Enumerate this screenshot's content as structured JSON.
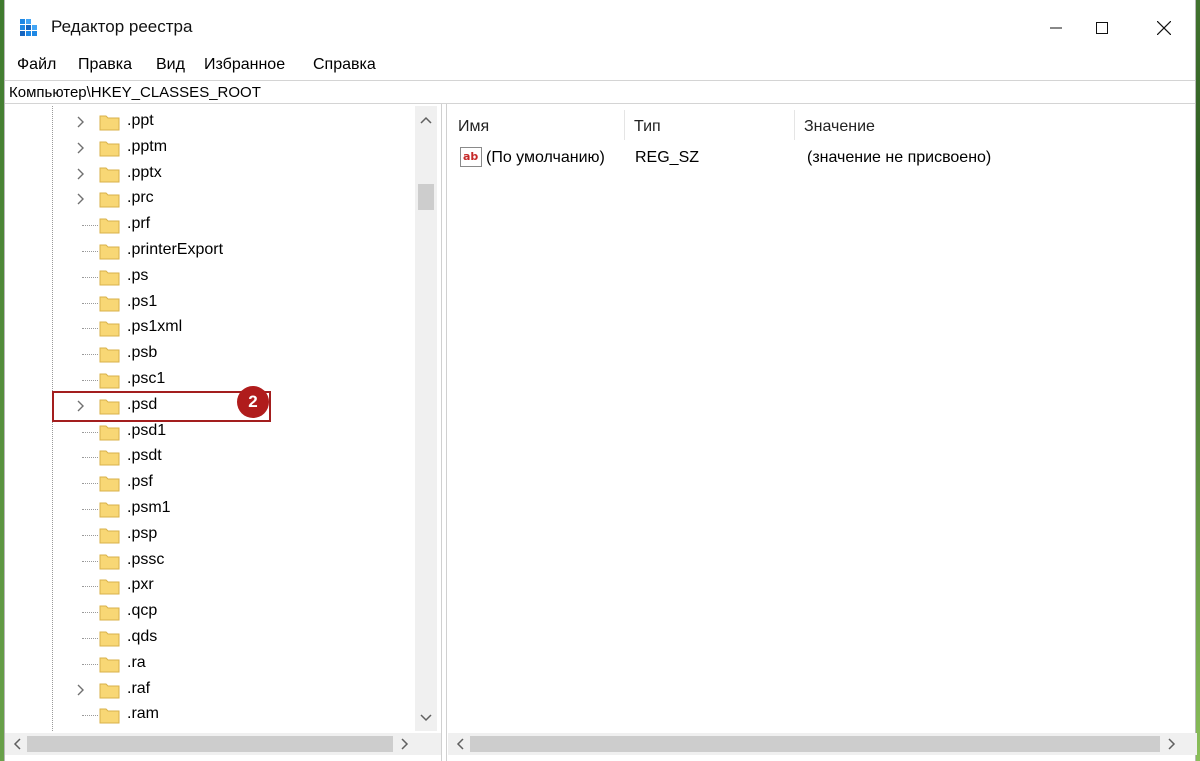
{
  "window": {
    "title": "Редактор реестра"
  },
  "menu": {
    "items": [
      "Файл",
      "Правка",
      "Вид",
      "Избранное",
      "Справка"
    ]
  },
  "address": {
    "path": "Компьютер\\HKEY_CLASSES_ROOT"
  },
  "tree": {
    "items": [
      {
        "label": ".ppt",
        "expandable": true
      },
      {
        "label": ".pptm",
        "expandable": true
      },
      {
        "label": ".pptx",
        "expandable": true
      },
      {
        "label": ".prc",
        "expandable": true
      },
      {
        "label": ".prf",
        "expandable": false
      },
      {
        "label": ".printerExport",
        "expandable": false
      },
      {
        "label": ".ps",
        "expandable": false
      },
      {
        "label": ".ps1",
        "expandable": false
      },
      {
        "label": ".ps1xml",
        "expandable": false
      },
      {
        "label": ".psb",
        "expandable": false
      },
      {
        "label": ".psc1",
        "expandable": false
      },
      {
        "label": ".psd",
        "expandable": true
      },
      {
        "label": ".psd1",
        "expandable": false
      },
      {
        "label": ".psdt",
        "expandable": false
      },
      {
        "label": ".psf",
        "expandable": false
      },
      {
        "label": ".psm1",
        "expandable": false
      },
      {
        "label": ".psp",
        "expandable": false
      },
      {
        "label": ".pssc",
        "expandable": false
      },
      {
        "label": ".pxr",
        "expandable": false
      },
      {
        "label": ".qcp",
        "expandable": false
      },
      {
        "label": ".qds",
        "expandable": false
      },
      {
        "label": ".ra",
        "expandable": false
      },
      {
        "label": ".raf",
        "expandable": true
      },
      {
        "label": ".ram",
        "expandable": false
      }
    ]
  },
  "list": {
    "columns": {
      "name": "Имя",
      "type": "Тип",
      "value": "Значение"
    },
    "rows": [
      {
        "name": "(По умолчанию)",
        "type": "REG_SZ",
        "value": "(значение не присвоено)",
        "icon": "ab"
      }
    ]
  },
  "annotation": {
    "badge": "2"
  },
  "colors": {
    "annotation_red": "#b01c1c",
    "folder_yellow": "#f8d775"
  }
}
